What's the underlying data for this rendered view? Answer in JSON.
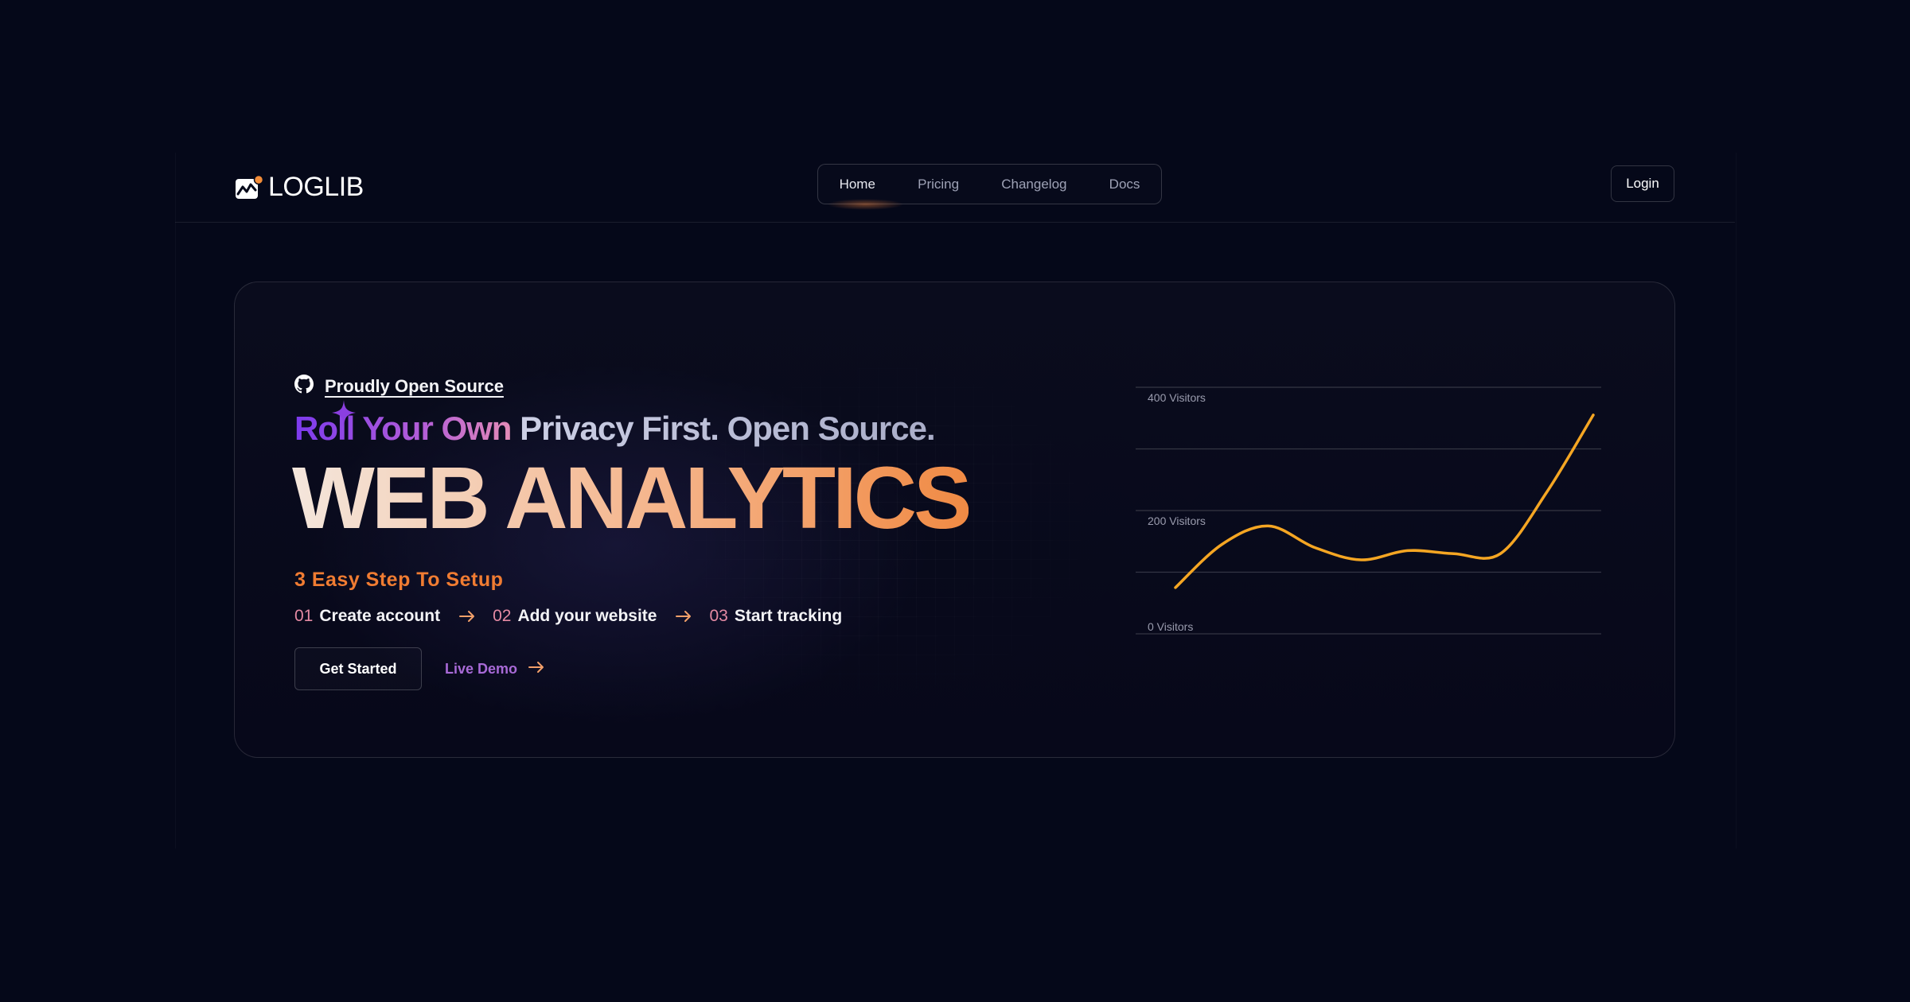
{
  "brand": {
    "name": "LOGLIB"
  },
  "nav": {
    "items": [
      {
        "label": "Home",
        "active": true
      },
      {
        "label": "Pricing",
        "active": false
      },
      {
        "label": "Changelog",
        "active": false
      },
      {
        "label": "Docs",
        "active": false
      }
    ],
    "login_label": "Login"
  },
  "hero": {
    "open_source_label": "Proudly Open Source",
    "tagline_accent": "Roll Your Own",
    "tagline_rest": " Privacy First. Open Source.",
    "headline": "WEB ANALYTICS",
    "setup_title": "3 Easy Step To Setup",
    "steps": [
      {
        "num": "01",
        "label": "Create account"
      },
      {
        "num": "02",
        "label": "Add your website"
      },
      {
        "num": "03",
        "label": "Start tracking"
      }
    ],
    "primary_button": "Get Started",
    "secondary_button": "Live Demo"
  },
  "colors": {
    "background": "#050819",
    "accent_orange": "#f08a44",
    "accent_purple": "#7c3aed",
    "line": "#f5a623"
  },
  "chart_data": {
    "type": "line",
    "y_tick_labels": [
      "400 Visitors",
      "200 Visitors",
      "0 Visitors"
    ],
    "ylim": [
      0,
      400
    ],
    "series": [
      {
        "values": [
          75,
          145,
          175,
          140,
          120,
          135,
          130,
          130,
          230,
          355
        ]
      }
    ]
  }
}
